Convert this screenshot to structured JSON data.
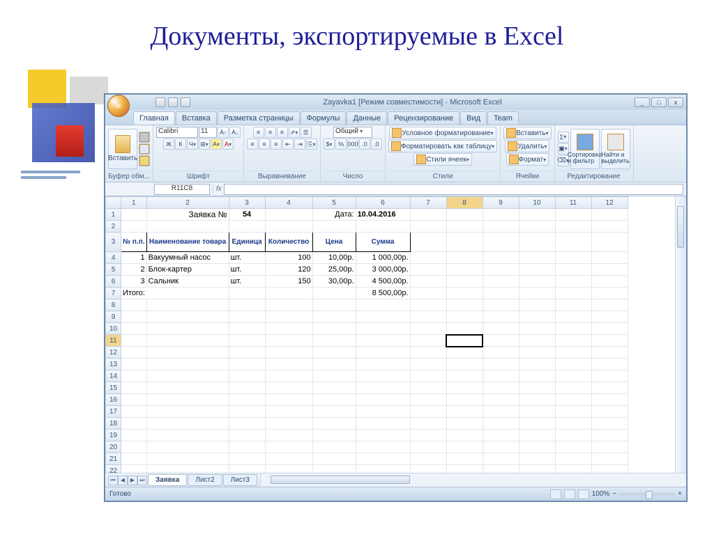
{
  "slide": {
    "title": "Документы, экспортируемые в Excel"
  },
  "window": {
    "title": "Zayavka1 [Режим совместимости] - Microsoft Excel",
    "min": "_",
    "max": "□",
    "close": "x"
  },
  "tabs": {
    "home": "Главная",
    "insert": "Вставка",
    "layout": "Разметка страницы",
    "formulas": "Формулы",
    "data": "Данные",
    "review": "Рецензирование",
    "view": "Вид",
    "team": "Team"
  },
  "ribbon": {
    "clipboard": {
      "paste": "Вставить",
      "label": "Буфер обм..."
    },
    "font": {
      "name": "Calibri",
      "size": "11",
      "bold": "Ж",
      "italic": "К",
      "underline": "Ч",
      "label": "Шрифт"
    },
    "align": {
      "wrap": "☰",
      "merge": "⎘",
      "label": "Выравнивание"
    },
    "number": {
      "format": "Общий",
      "label": "Число"
    },
    "styles": {
      "cond": "Условное форматирование",
      "table": "Форматировать как таблицу",
      "cell": "Стили ячеек",
      "label": "Стили"
    },
    "cells": {
      "insert": "Вставить",
      "delete": "Удалить",
      "format": "Формат",
      "label": "Ячейки"
    },
    "editing": {
      "sort": "Сортировка и фильтр",
      "find": "Найти и выделить",
      "label": "Редактирование"
    }
  },
  "namebox": "R11C8",
  "sheet": {
    "title_label": "Заявка №",
    "title_num": "54",
    "date_label": "Дата:",
    "date_val": "10.04.2016",
    "headers": {
      "num": "№ п.п.",
      "name": "Наименование товара",
      "unit": "Единица",
      "qty": "Количество",
      "price": "Цена",
      "sum": "Сумма"
    },
    "rows": [
      {
        "n": "1",
        "name": "Вакуумный насос",
        "unit": "шт.",
        "qty": "100",
        "price": "10,00р.",
        "sum": "1 000,00р."
      },
      {
        "n": "2",
        "name": "Блок-картер",
        "unit": "шт.",
        "qty": "120",
        "price": "25,00р.",
        "sum": "3 000,00р."
      },
      {
        "n": "3",
        "name": "Сальник",
        "unit": "шт.",
        "qty": "150",
        "price": "30,00р.",
        "sum": "4 500,00р."
      }
    ],
    "total_label": "Итого:",
    "total": "8 500,00р."
  },
  "sheets": {
    "s1": "Заявка",
    "s2": "Лист2",
    "s3": "Лист3"
  },
  "status": {
    "ready": "Готово",
    "zoom": "100%"
  },
  "colheads": [
    "1",
    "2",
    "3",
    "4",
    "5",
    "6",
    "7",
    "8",
    "9",
    "10",
    "11",
    "12"
  ]
}
